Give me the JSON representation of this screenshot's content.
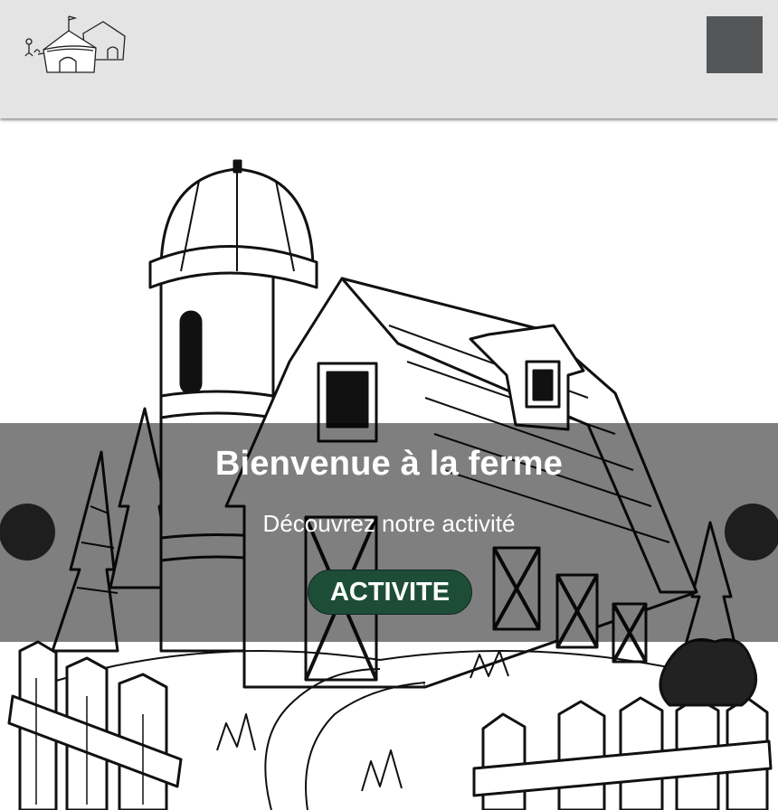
{
  "header": {
    "logo_icon": "farm-huts-logo-icon",
    "menu_icon": "menu-toggle-icon"
  },
  "hero": {
    "image_icon": "barn-illustration",
    "title": "Bienvenue à la ferme",
    "subtitle": "Découvrez notre activité",
    "cta_label": "ACTIVITE",
    "prev_icon": "carousel-prev-button",
    "next_icon": "carousel-next-button"
  },
  "colors": {
    "header_bg": "#e4e4e4",
    "menu_button": "#545658",
    "cta_bg": "#1d4d37",
    "overlay": "rgba(0,0,0,0.5)",
    "arrow": "#1e1e1e"
  }
}
